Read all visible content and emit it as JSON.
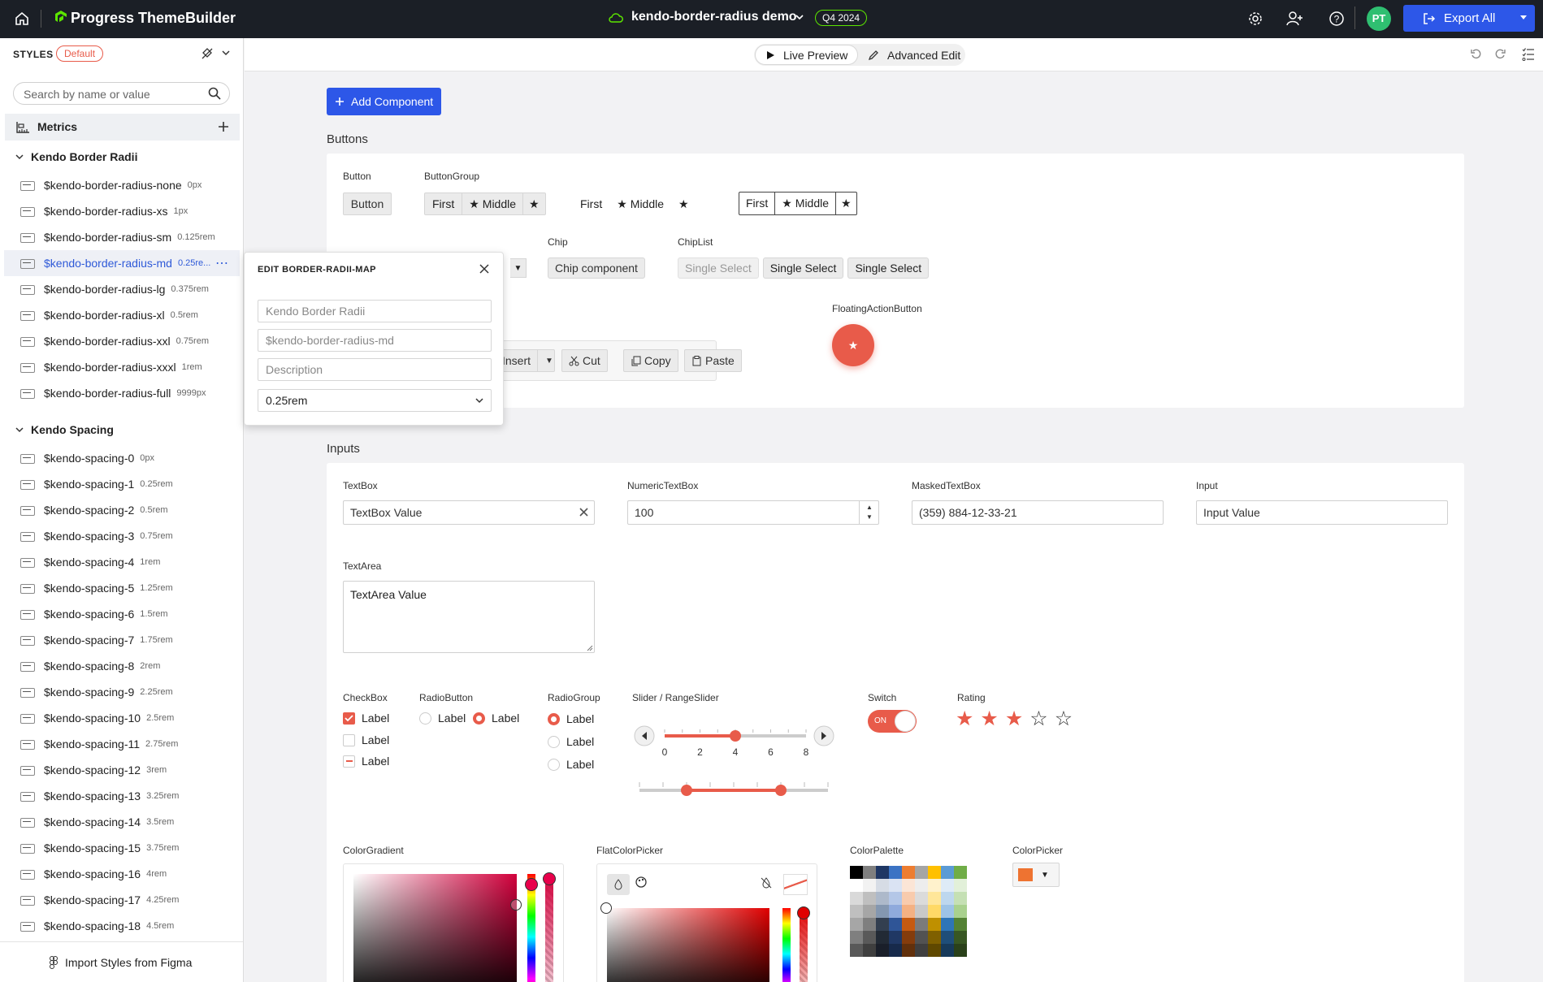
{
  "topbar": {
    "home_icon": "home-icon",
    "brand": "Progress ThemeBuilder",
    "project_name": "kendo-border-radius demo",
    "version_badge": "Q4 2024",
    "avatar_initials": "PT",
    "export_label": "Export All"
  },
  "sidebar": {
    "styles_label": "STYLES",
    "default_badge": "Default",
    "search_placeholder": "Search by name or value",
    "metrics_label": "Metrics",
    "group1": {
      "title": "Kendo Border Radii",
      "items": [
        {
          "name": "$kendo-border-radius-none",
          "value": "0px"
        },
        {
          "name": "$kendo-border-radius-xs",
          "value": "1px"
        },
        {
          "name": "$kendo-border-radius-sm",
          "value": "0.125rem"
        },
        {
          "name": "$kendo-border-radius-md",
          "value": "0.25re..."
        },
        {
          "name": "$kendo-border-radius-lg",
          "value": "0.375rem"
        },
        {
          "name": "$kendo-border-radius-xl",
          "value": "0.5rem"
        },
        {
          "name": "$kendo-border-radius-xxl",
          "value": "0.75rem"
        },
        {
          "name": "$kendo-border-radius-xxxl",
          "value": "1rem"
        },
        {
          "name": "$kendo-border-radius-full",
          "value": "9999px"
        }
      ]
    },
    "group2": {
      "title": "Kendo Spacing",
      "items": [
        {
          "name": "$kendo-spacing-0",
          "value": "0px"
        },
        {
          "name": "$kendo-spacing-1",
          "value": "0.25rem"
        },
        {
          "name": "$kendo-spacing-2",
          "value": "0.5rem"
        },
        {
          "name": "$kendo-spacing-3",
          "value": "0.75rem"
        },
        {
          "name": "$kendo-spacing-4",
          "value": "1rem"
        },
        {
          "name": "$kendo-spacing-5",
          "value": "1.25rem"
        },
        {
          "name": "$kendo-spacing-6",
          "value": "1.5rem"
        },
        {
          "name": "$kendo-spacing-7",
          "value": "1.75rem"
        },
        {
          "name": "$kendo-spacing-8",
          "value": "2rem"
        },
        {
          "name": "$kendo-spacing-9",
          "value": "2.25rem"
        },
        {
          "name": "$kendo-spacing-10",
          "value": "2.5rem"
        },
        {
          "name": "$kendo-spacing-11",
          "value": "2.75rem"
        },
        {
          "name": "$kendo-spacing-12",
          "value": "3rem"
        },
        {
          "name": "$kendo-spacing-13",
          "value": "3.25rem"
        },
        {
          "name": "$kendo-spacing-14",
          "value": "3.5rem"
        },
        {
          "name": "$kendo-spacing-15",
          "value": "3.75rem"
        },
        {
          "name": "$kendo-spacing-16",
          "value": "4rem"
        },
        {
          "name": "$kendo-spacing-17",
          "value": "4.25rem"
        },
        {
          "name": "$kendo-spacing-18",
          "value": "4.5rem"
        }
      ]
    },
    "import_label": "Import Styles from Figma"
  },
  "toolbar": {
    "live_preview": "Live Preview",
    "advanced_edit": "Advanced Edit"
  },
  "popup": {
    "title": "EDIT BORDER-RADII-MAP",
    "group_value": "Kendo Border Radii",
    "name_value": "$kendo-border-radius-md",
    "description_placeholder": "Description",
    "selected_value": "0.25rem"
  },
  "canvas": {
    "add_component": "Add Component",
    "buttons_section": "Buttons",
    "button_label": "Button",
    "button_text": "Button",
    "buttongroup_label": "ButtonGroup",
    "bg_first": "First",
    "bg_middle": "Middle",
    "chip_label": "Chip",
    "chip_text": "Chip component",
    "chiplist_label": "ChipList",
    "chiplist_items": [
      "Single Select",
      "Single Select",
      "Single Select"
    ],
    "fab_label": "FloatingActionButton",
    "tb_insert": "Insert",
    "tb_cut": "Cut",
    "tb_copy": "Copy",
    "tb_paste": "Paste",
    "inputs_section": "Inputs",
    "textbox_label": "TextBox",
    "textbox_value": "TextBox Value",
    "numeric_label": "NumericTextBox",
    "numeric_value": "100",
    "masked_label": "MaskedTextBox",
    "masked_value": "(359) 884-12-33-21",
    "input_label": "Input",
    "input_value": "Input Value",
    "textarea_label": "TextArea",
    "textarea_value": "TextArea Value",
    "checkbox_label": "CheckBox",
    "radio_label": "RadioButton",
    "radiogroup_label": "RadioGroup",
    "slider_label": "Slider / RangeSlider",
    "switch_label": "Switch",
    "switch_on": "ON",
    "rating_label": "Rating",
    "item_label": "Label",
    "slider_ticks": [
      "0",
      "2",
      "4",
      "6",
      "8"
    ],
    "slider_value": 4,
    "range_values": [
      2,
      6
    ],
    "rating_value": 3,
    "rating_max": 5,
    "colorgradient_label": "ColorGradient",
    "flatcolorpicker_label": "FlatColorPicker",
    "colorpalette_label": "ColorPalette",
    "colorpicker_label": "ColorPicker",
    "colorpicker_value": "#ee7331"
  },
  "colors": {
    "accent": "#e85b4a",
    "primary": "#2d57e8",
    "topbar": "#1b1f26"
  },
  "palette": [
    [
      "#000000",
      "#7f7f7f",
      "#1f3764",
      "#3b73c4",
      "#ed7d31",
      "#a5a5a5",
      "#ffc000",
      "#5b9bd5",
      "#70ad47"
    ],
    [
      "#ffffff",
      "#f2f2f2",
      "#d6dce5",
      "#dae3f3",
      "#fbe5d6",
      "#ededed",
      "#fff2cc",
      "#deebf7",
      "#e2f0d9"
    ],
    [
      "#d9d9d9",
      "#bfbfbf",
      "#adb9ca",
      "#b4c7e7",
      "#f8cbad",
      "#dbdbdb",
      "#ffe699",
      "#bdd7ee",
      "#c5e0b4"
    ],
    [
      "#bfbfbf",
      "#a6a6a6",
      "#8497b0",
      "#8faadc",
      "#f4b183",
      "#c9c9c9",
      "#ffd966",
      "#9dc3e6",
      "#a9d18e"
    ],
    [
      "#a6a6a6",
      "#7f7f7f",
      "#333f50",
      "#2f5597",
      "#c55a11",
      "#7b7b7b",
      "#bf9000",
      "#2e75b6",
      "#548235"
    ],
    [
      "#7f7f7f",
      "#595959",
      "#222a35",
      "#203864",
      "#843c0c",
      "#525252",
      "#7f6000",
      "#1f4e79",
      "#385723"
    ],
    [
      "#595959",
      "#3f3f3f",
      "#1a1f2a",
      "#172a4b",
      "#62300b",
      "#3f3f3f",
      "#5f4800",
      "#173a5b",
      "#2a411a"
    ]
  ]
}
